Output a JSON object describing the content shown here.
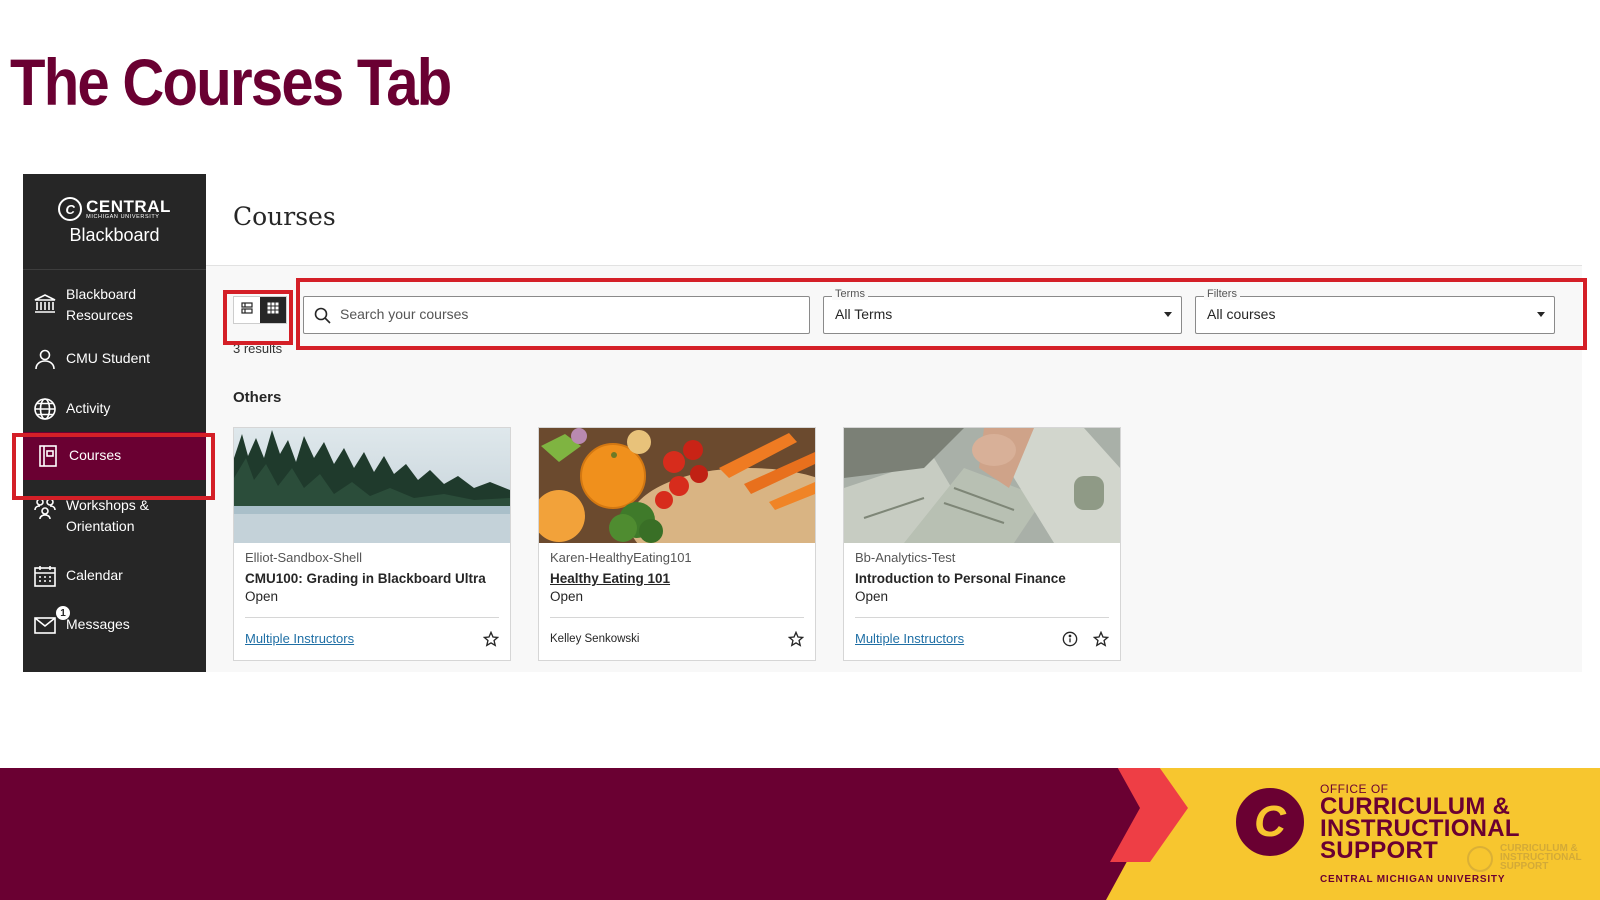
{
  "slide": {
    "title": "The Courses Tab"
  },
  "sidebar": {
    "logo_line1": "CENTRAL",
    "logo_line2": "MICHIGAN UNIVERSITY",
    "logo_line3": "Blackboard",
    "items": [
      {
        "label_line1": "Blackboard",
        "label_line2": "Resources",
        "icon": "institution-icon"
      },
      {
        "label": "CMU Student",
        "icon": "person-icon"
      },
      {
        "label": "Activity",
        "icon": "globe-icon"
      },
      {
        "label": "Courses",
        "icon": "courses-icon",
        "active": true
      },
      {
        "label_line1": "Workshops &",
        "label_line2": "Orientation",
        "icon": "group-icon"
      },
      {
        "label": "Calendar",
        "icon": "calendar-icon"
      },
      {
        "label": "Messages",
        "icon": "envelope-icon",
        "badge": "1"
      }
    ]
  },
  "main": {
    "title": "Courses",
    "search": {
      "placeholder": "Search your courses",
      "value": ""
    },
    "terms": {
      "label": "Terms",
      "value": "All Terms"
    },
    "filters": {
      "label": "Filters",
      "value": "All courses"
    },
    "results": "3 results",
    "section": "Others",
    "cards": [
      {
        "code": "Elliot-Sandbox-Shell",
        "name": "CMU100: Grading in Blackboard Ultra",
        "status": "Open",
        "instructors": "Multiple Instructors"
      },
      {
        "code": "Karen-HealthyEating101",
        "name": "Healthy Eating 101",
        "status": "Open",
        "instructors": "Kelley Senkowski"
      },
      {
        "code": "Bb-Analytics-Test",
        "name": "Introduction to Personal Finance",
        "status": "Open",
        "instructors": "Multiple Instructors"
      }
    ]
  },
  "footer": {
    "office": "OFFICE OF",
    "name_line1": "CURRICULUM &",
    "name_line2": "INSTRUCTIONAL",
    "name_line3": "SUPPORT",
    "university": "CENTRAL MICHIGAN UNIVERSITY",
    "ghost_line1": "CURRICULUM &",
    "ghost_line2": "INSTRUCTIONAL",
    "ghost_line3": "SUPPORT"
  },
  "colors": {
    "maroon": "#6a0032",
    "gold": "#f7c62f",
    "red_accent": "#ee3e45",
    "highlight_red": "#d41f27",
    "sidebar_bg": "#262626",
    "link_blue": "#1f6fa5"
  }
}
